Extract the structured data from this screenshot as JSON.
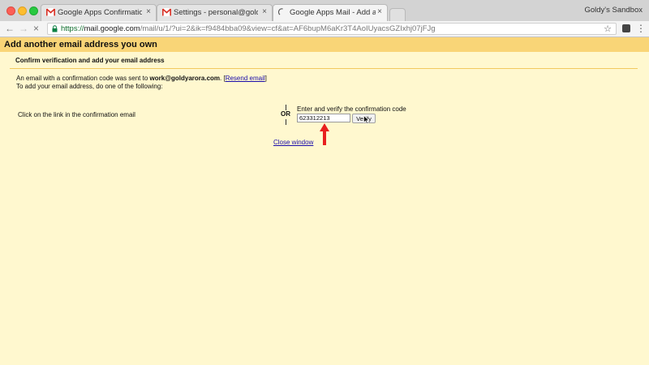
{
  "browser": {
    "tabs": [
      {
        "label": "Google Apps Confirmation - Se",
        "icon": "gmail-icon",
        "active": false
      },
      {
        "label": "Settings - personal@goldyarora",
        "icon": "gmail-icon",
        "active": false
      },
      {
        "label": "Google Apps Mail - Add anothe",
        "icon": "loading-spinner-icon",
        "active": true
      }
    ],
    "profile_name": "Goldy's Sandbox",
    "close_glyph": "×",
    "url_scheme": "https://",
    "url_host": "mail.google.com",
    "url_path": "/mail/u/1/?ui=2&ik=f9484bba09&view=cf&at=AF6bupM6aKr3T4AoIUyacsGZIxhj07jFJg"
  },
  "page": {
    "title": "Add another email address you own",
    "subtitle": "Confirm verification and add your email address",
    "message_prefix": "An email with a confirmation code was sent to ",
    "email": "work@goldyarora.com",
    "message_suffix": ". [",
    "resend_link": "Resend email",
    "message_end": "]",
    "instruction": "To add your email address, do one of the following:",
    "option_link": "Click on the link in the confirmation email",
    "or_label": "OR",
    "option_code": "Enter and verify the confirmation code",
    "code_value": "623312213",
    "verify_label": "Verify",
    "close_window": "Close window"
  },
  "colors": {
    "header_bg": "#f9d577",
    "page_bg": "#fff8cf",
    "link": "#1a0dab",
    "arrow": "#e8201f"
  }
}
